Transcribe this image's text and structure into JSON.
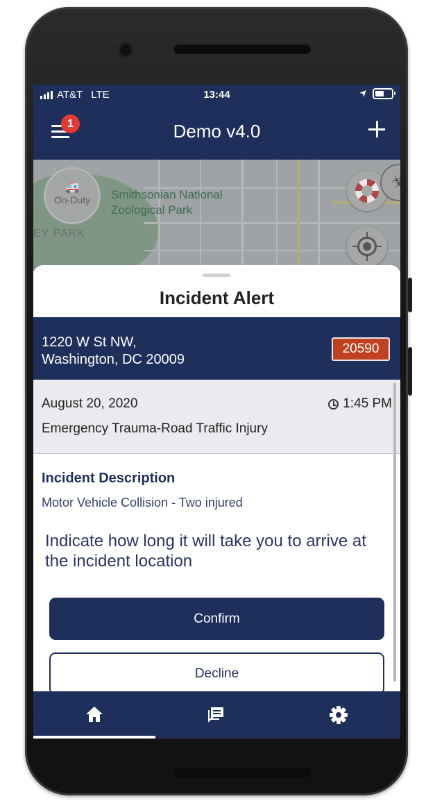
{
  "status_bar": {
    "carrier": "AT&T",
    "network": "LTE",
    "time": "13:44"
  },
  "app_bar": {
    "title": "Demo v4.0",
    "notification_count": "1"
  },
  "map": {
    "poi_label_line1": "Smithsonian National",
    "poi_label_line2": "Zoological Park",
    "area_label": "EY PARK",
    "status_button_label": "On-Duty"
  },
  "sheet": {
    "title": "Incident Alert",
    "address_line1": "1220 W St NW,",
    "address_line2": "Washington, DC 20009",
    "incident_code": "20590",
    "date": "August 20, 2020",
    "time": "1:45 PM",
    "incident_type": "Emergency Trauma-Road Traffic Injury",
    "description_heading": "Incident Description",
    "description_text": "Motor Vehicle Collision - Two injured",
    "prompt": "Indicate how long it will take you to arrive at the incident location",
    "confirm_label": "Confirm",
    "decline_label": "Decline"
  },
  "tab_bar": {
    "tabs": [
      {
        "icon": "home-icon",
        "active": true
      },
      {
        "icon": "chat-icon",
        "active": false
      },
      {
        "icon": "gear-icon",
        "active": false
      }
    ]
  },
  "colors": {
    "primary": "#1f2f5b",
    "badge_red": "#e53935",
    "code_badge": "#c1401f"
  }
}
